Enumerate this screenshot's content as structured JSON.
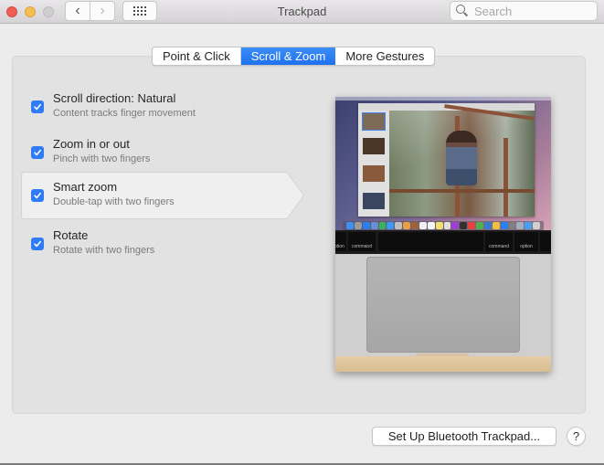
{
  "window": {
    "title": "Trackpad",
    "search_placeholder": "Search",
    "search_value": ""
  },
  "toolbar": {
    "back_icon": "chevron-left-icon",
    "forward_icon": "chevron-right-icon",
    "show_all_icon": "grid-icon",
    "back_glyph": "‹",
    "forward_glyph": "›"
  },
  "tabs": [
    {
      "label": "Point & Click",
      "active": false
    },
    {
      "label": "Scroll & Zoom",
      "active": true
    },
    {
      "label": "More Gestures",
      "active": false
    }
  ],
  "options": [
    {
      "title": "Scroll direction: Natural",
      "subtitle": "Content tracks finger movement",
      "checked": true,
      "selected": false
    },
    {
      "title": "Zoom in or out",
      "subtitle": "Pinch with two fingers",
      "checked": true,
      "selected": false
    },
    {
      "title": "Smart zoom",
      "subtitle": "Double-tap with two fingers",
      "checked": true,
      "selected": true
    },
    {
      "title": "Rotate",
      "subtitle": "Rotate with two fingers",
      "checked": true,
      "selected": false
    }
  ],
  "preview": {
    "keys": [
      "option",
      "command",
      "command",
      "option"
    ]
  },
  "footer": {
    "setup_button": "Set Up Bluetooth Trackpad...",
    "help_button": "?"
  },
  "colors": {
    "accent": "#2f7cf6",
    "close": "#ed5f56",
    "minimize": "#f5bf4f",
    "zoom_disabled": "#d0cfd0"
  }
}
